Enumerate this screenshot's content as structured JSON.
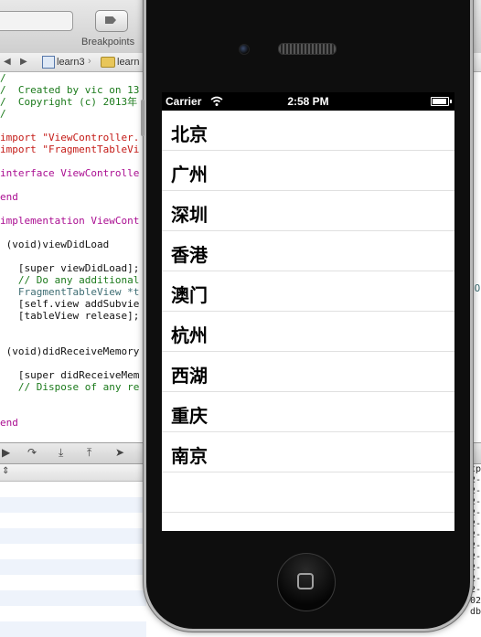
{
  "xcode": {
    "breakpoints_label": "Breakpoints",
    "jumpbar": {
      "project": "learn3",
      "folder": "learn"
    },
    "code_lines": [
      {
        "cls": "cmt",
        "text": "/"
      },
      {
        "cls": "cmt",
        "text": "/  Created by vic on 13"
      },
      {
        "cls": "cmt",
        "text": "/  Copyright (c) 2013年"
      },
      {
        "cls": "cmt",
        "text": "/"
      },
      {
        "cls": "plain",
        "text": ""
      },
      {
        "cls": "str",
        "text": "import \"ViewController."
      },
      {
        "cls": "str",
        "text": "import \"FragmentTableVi"
      },
      {
        "cls": "plain",
        "text": ""
      },
      {
        "cls": "kw",
        "text": "interface ViewControlle"
      },
      {
        "cls": "plain",
        "text": ""
      },
      {
        "cls": "kw",
        "text": "end"
      },
      {
        "cls": "plain",
        "text": ""
      },
      {
        "cls": "kw",
        "text": "implementation ViewCont"
      },
      {
        "cls": "plain",
        "text": ""
      },
      {
        "cls": "plain",
        "text": " (void)viewDidLoad"
      },
      {
        "cls": "plain",
        "text": ""
      },
      {
        "cls": "plain",
        "text": "   [super viewDidLoad];"
      },
      {
        "cls": "cmt",
        "text": "   // Do any additional"
      },
      {
        "cls": "cls",
        "text": "   FragmentTableView *t"
      },
      {
        "cls": "plain",
        "text": "   [self.view addSubvie"
      },
      {
        "cls": "plain",
        "text": "   [tableView release];"
      },
      {
        "cls": "plain",
        "text": ""
      },
      {
        "cls": "plain",
        "text": ""
      },
      {
        "cls": "plain",
        "text": " (void)didReceiveMemory"
      },
      {
        "cls": "plain",
        "text": ""
      },
      {
        "cls": "plain",
        "text": "   [super didReceiveMem"
      },
      {
        "cls": "cmt",
        "text": "   // Dispose of any re"
      },
      {
        "cls": "plain",
        "text": ""
      },
      {
        "cls": "plain",
        "text": ""
      },
      {
        "cls": "kw",
        "text": "end"
      }
    ],
    "right_code": "CO",
    "console_lines": [
      "tp",
      "2-",
      "2-",
      "2-",
      "2-",
      "2-",
      "2-",
      "2-",
      "2-",
      "2-",
      "2-",
      "2-",
      "02-",
      "db)"
    ]
  },
  "simulator": {
    "status": {
      "carrier": "Carrier",
      "time": "2:58 PM"
    },
    "cities": [
      "北京",
      "广州",
      "深圳",
      "香港",
      "澳门",
      "杭州",
      "西湖",
      "重庆",
      "南京",
      "",
      ""
    ]
  }
}
